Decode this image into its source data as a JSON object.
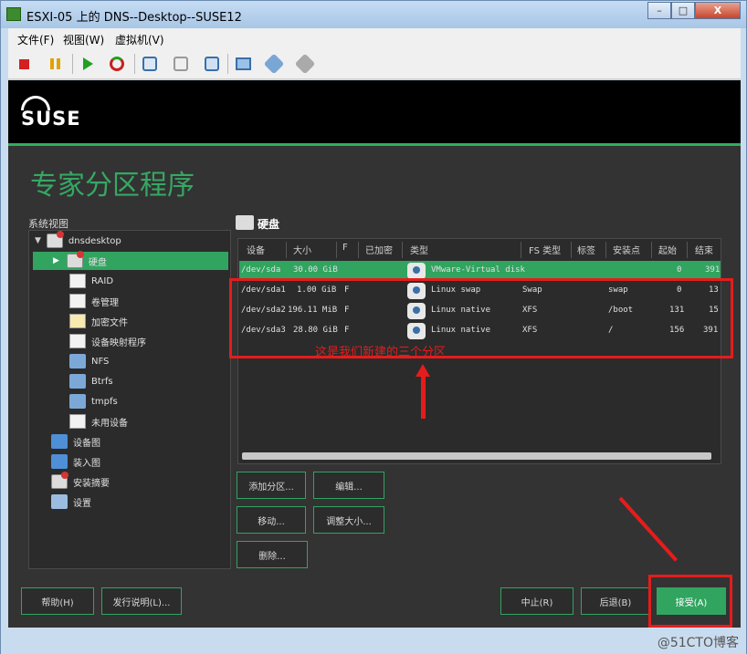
{
  "window": {
    "title": "ESXI-05 上的 DNS--Desktop--SUSE12",
    "min": "–",
    "max": "□",
    "close": "X"
  },
  "menubar": [
    "文件(F)",
    "视图(W)",
    "虚拟机(V)"
  ],
  "toolbar_icons": [
    "stop-icon",
    "pause-icon",
    "play-icon",
    "reset-icon",
    "snapshot-icon",
    "revert-snapshot-icon",
    "snapshot-manager-icon",
    "console-icon",
    "settings-icon",
    "tools-icon"
  ],
  "installer": {
    "logo": "SUSE",
    "page_title": "专家分区程序",
    "system_view_label": "系统视图",
    "tree": [
      {
        "label": "dnsdesktop",
        "icon": "computer-disk-icon"
      },
      {
        "label": "硬盘",
        "icon": "hard-disk-icon",
        "selected": true
      },
      {
        "label": "RAID",
        "icon": "raid-icon"
      },
      {
        "label": "卷管理",
        "icon": "volume-management-icon"
      },
      {
        "label": "加密文件",
        "icon": "encrypted-file-icon"
      },
      {
        "label": "设备映射程序",
        "icon": "device-mapper-icon"
      },
      {
        "label": "NFS",
        "icon": "folder-icon"
      },
      {
        "label": "Btrfs",
        "icon": "folder-icon"
      },
      {
        "label": "tmpfs",
        "icon": "folder-icon"
      },
      {
        "label": "未用设备",
        "icon": "unused-device-icon"
      },
      {
        "label": "设备图",
        "icon": "device-graph-icon"
      },
      {
        "label": "装入图",
        "icon": "mount-graph-icon"
      },
      {
        "label": "安装摘要",
        "icon": "install-summary-icon"
      },
      {
        "label": "设置",
        "icon": "tools-icon"
      }
    ],
    "section_title": "硬盘",
    "table": {
      "headers": [
        "设备",
        "大小",
        "F",
        "已加密",
        "类型",
        "FS 类型",
        "标签",
        "安装点",
        "起始",
        "结束"
      ],
      "rows": [
        {
          "device": "/dev/sda",
          "size": "30.00 GiB",
          "f": "",
          "enc": "",
          "type": "VMware-Virtual disk",
          "fs": "",
          "label": "",
          "mount": "",
          "start": "0",
          "end": "391",
          "selected": true
        },
        {
          "device": "/dev/sda1",
          "size": "1.00 GiB",
          "f": "F",
          "enc": "",
          "type": "Linux swap",
          "fs": "Swap",
          "label": "",
          "mount": "swap",
          "start": "0",
          "end": "13"
        },
        {
          "device": "/dev/sda2",
          "size": "196.11 MiB",
          "f": "F",
          "enc": "",
          "type": "Linux native",
          "fs": "XFS",
          "label": "",
          "mount": "/boot",
          "start": "131",
          "end": "15"
        },
        {
          "device": "/dev/sda3",
          "size": "28.80 GiB",
          "f": "F",
          "enc": "",
          "type": "Linux native",
          "fs": "XFS",
          "label": "",
          "mount": "/",
          "start": "156",
          "end": "391"
        }
      ]
    },
    "buttons": {
      "add_partition": "添加分区...",
      "edit": "编辑...",
      "move": "移动...",
      "resize": "调整大小...",
      "delete": "删除...",
      "help": "帮助(H)",
      "release_notes": "发行说明(L)...",
      "abort": "中止(R)",
      "back": "后退(B)",
      "accept": "接受(A)"
    },
    "annotation": "这是我们新建的三个分区"
  },
  "watermark": "@51CTO博客",
  "colors": {
    "accent": "#31a460",
    "annotation": "#e51c1c",
    "background": "#333333"
  }
}
